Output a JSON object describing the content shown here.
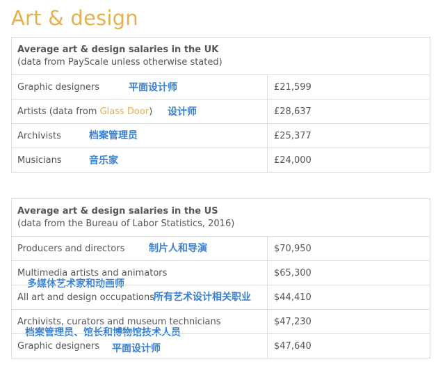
{
  "page": {
    "title": "Art & design"
  },
  "uk_table": {
    "title": "Average art & design salaries in the UK",
    "subtitle": "(data from PayScale unless otherwise stated)",
    "rows": [
      {
        "label": "Graphic designers",
        "value": "£21,599",
        "annotation": "平面设计师"
      },
      {
        "label_prefix": "Artists (data from ",
        "label_link": "Glass Door",
        "label_suffix": ")",
        "value": "£28,637",
        "annotation": "设计师"
      },
      {
        "label": "Archivists",
        "value": "£25,377",
        "annotation": "档案管理员"
      },
      {
        "label": "Musicians",
        "value": "£24,000",
        "annotation": "音乐家"
      }
    ]
  },
  "us_table": {
    "title": "Average art & design salaries in the US",
    "subtitle": "(data from the Bureau of Labor Statistics, 2016)",
    "rows": [
      {
        "label": "Producers and directors",
        "value": "$70,950",
        "annotation": "制片人和导演"
      },
      {
        "label": "Multimedia artists and animators",
        "value": "$65,300",
        "annotation": "多媒体艺术家和动画师"
      },
      {
        "label": "All art and design occupations",
        "value": "$44,410",
        "annotation": "所有艺术设计相关职业"
      },
      {
        "label": "Archivists, curators and museum technicians",
        "value": "$47,230",
        "annotation": "档案管理员、馆长和博物馆技术人员"
      },
      {
        "label": "Graphic designers",
        "value": "$47,640",
        "annotation": "平面设计师"
      }
    ]
  },
  "colors": {
    "title": "#e8b04a",
    "link": "#e8b04a",
    "annotation": "#3a7fd0",
    "text": "#555555",
    "border": "#dcdcdc"
  }
}
